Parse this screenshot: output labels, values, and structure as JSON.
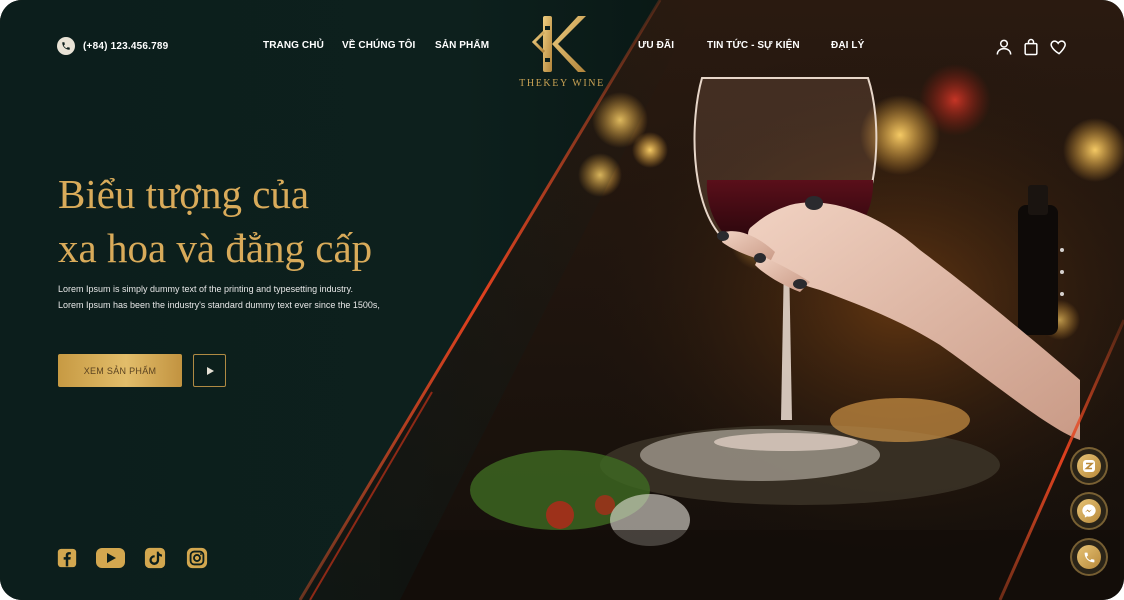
{
  "header": {
    "phone": "(+84) 123.456.789",
    "nav_left": [
      "TRANG CHỦ",
      "VỀ CHÚNG TÔI",
      "SẢN PHẨM"
    ],
    "nav_right": [
      "ƯU ĐÃI",
      "TIN TỨC - SỰ KIỆN",
      "ĐẠI LÝ"
    ],
    "logo_text": "THEKEY WINE",
    "icons": [
      "user-icon",
      "shopping-bag-icon",
      "heart-icon"
    ]
  },
  "hero": {
    "headline_line1": "Biểu tượng của",
    "headline_line2": "xa hoa và đẳng cấp",
    "desc_line1": "Lorem Ipsum is simply dummy text of the printing and typesetting industry.",
    "desc_line2": "Lorem Ipsum has been the industry's standard dummy text ever since the 1500s,",
    "cta_label": "XEM SẢN PHẨM",
    "play_icon": "play-icon"
  },
  "social": [
    "facebook-icon",
    "youtube-icon",
    "tiktok-icon",
    "instagram-icon"
  ],
  "floating": [
    "zalo-icon",
    "messenger-icon",
    "phone-icon"
  ],
  "colors": {
    "gold": "#d9ab5a",
    "dark_green": "#0c1f1c",
    "accent_red": "#e0401e"
  }
}
